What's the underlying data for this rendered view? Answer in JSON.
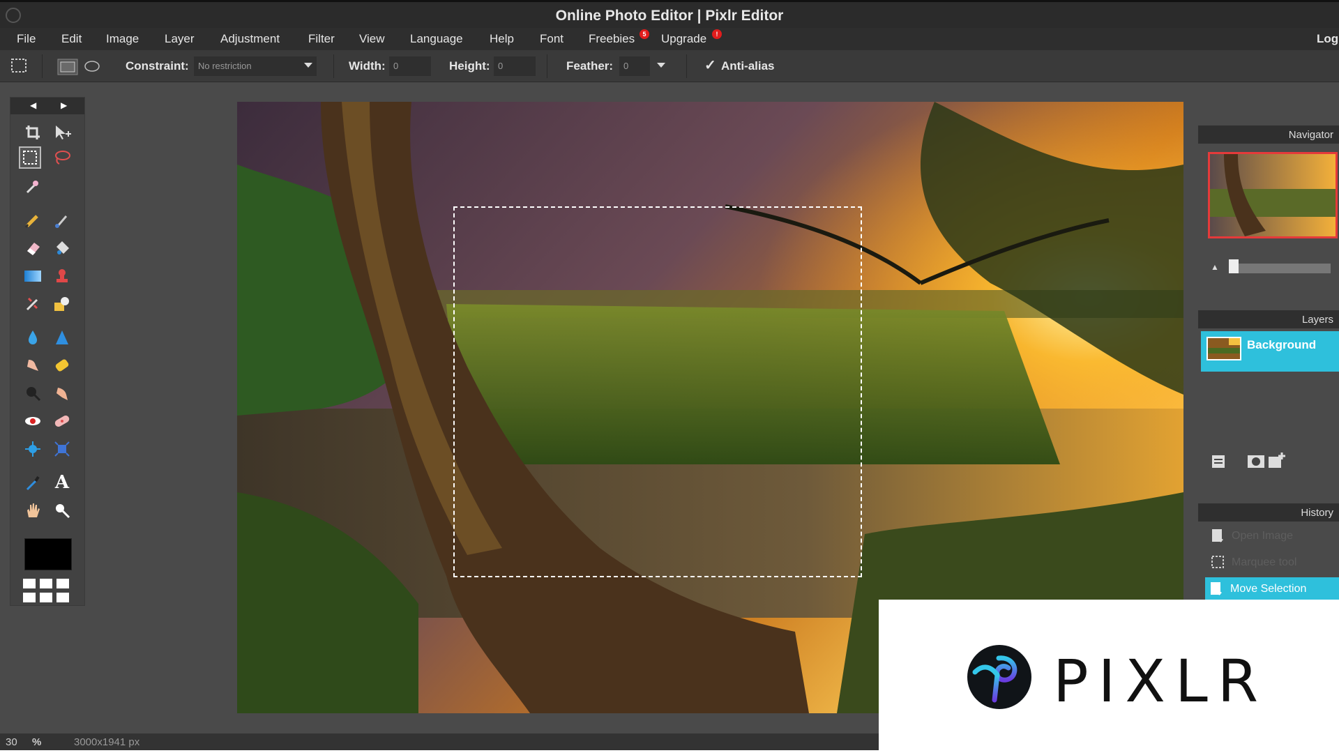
{
  "window": {
    "title": "Online Photo Editor | Pixlr Editor"
  },
  "menu": {
    "items": [
      "File",
      "Edit",
      "Image",
      "Layer",
      "Adjustment",
      "Filter",
      "View",
      "Language",
      "Help",
      "Font",
      "Freebies",
      "Upgrade"
    ],
    "freebies_badge": "5",
    "upgrade_badge": "!",
    "login": "Log"
  },
  "options": {
    "constraint_label": "Constraint:",
    "constraint_value": "No restriction",
    "width_label": "Width:",
    "width_value": "0",
    "height_label": "Height:",
    "height_value": "0",
    "feather_label": "Feather:",
    "feather_value": "0",
    "antialias_label": "Anti-alias",
    "antialias_checked": true
  },
  "panels": {
    "navigator_title": "Navigator",
    "layers_title": "Layers",
    "layers": [
      {
        "name": "Background"
      }
    ],
    "history_title": "History",
    "history": [
      {
        "label": "Open Image",
        "active": false
      },
      {
        "label": "Marquee tool",
        "active": false
      },
      {
        "label": "Move Selection",
        "active": true
      }
    ]
  },
  "status": {
    "zoom": "30",
    "zoom_unit": "%",
    "dimensions": "3000x1941 px"
  },
  "brand": {
    "name": "PIXLR"
  },
  "colors": {
    "accent": "#2ec0dc",
    "badge": "#e21c1c",
    "foreground_color": "#000000",
    "navigator_frame": "#e53a3a"
  }
}
